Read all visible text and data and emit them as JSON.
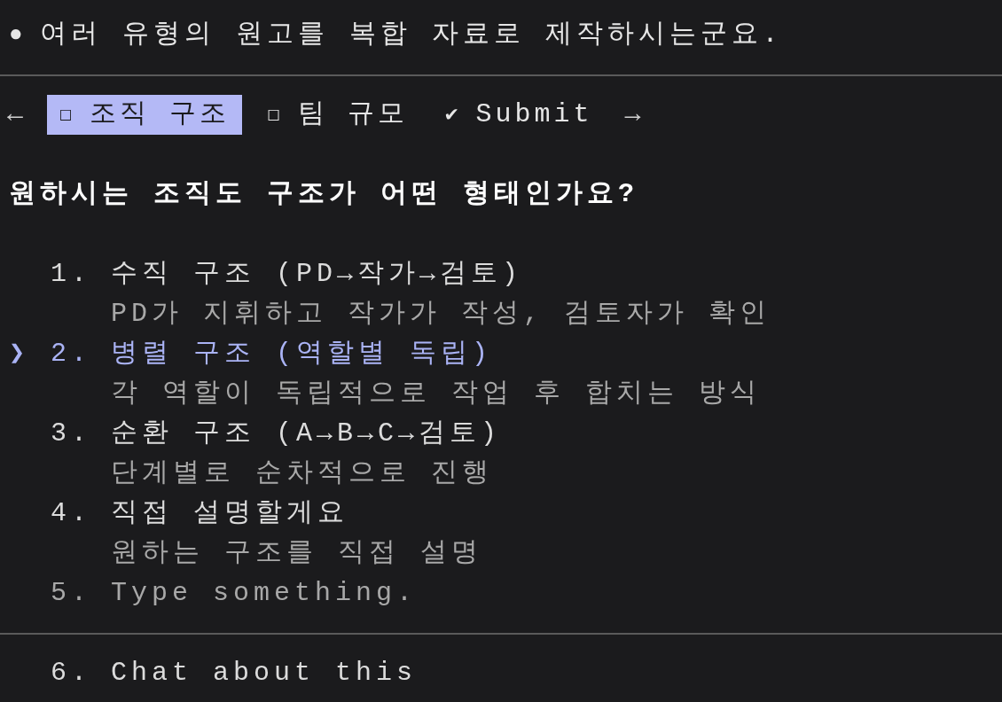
{
  "message": {
    "bullet": "●",
    "text": "여러 유형의 원고를 복합 자료로 제작하시는군요."
  },
  "tabs_bar": {
    "prev": "←",
    "next": "→",
    "tabs": [
      {
        "icon": "☐",
        "label": "조직 구조",
        "selected": true
      },
      {
        "icon": "☐",
        "label": "팀 규모",
        "selected": false
      },
      {
        "icon": "✔",
        "label": "Submit",
        "selected": false
      }
    ]
  },
  "question": "원하시는 조직도 구조가 어떤 형태인가요?",
  "cursor": "❯",
  "options": [
    {
      "kind": "choice",
      "number": "1.",
      "label": "수직 구조 (PD→작가→검토)",
      "description": "PD가 지휘하고 작가가 작성, 검토자가 확인",
      "selected": false
    },
    {
      "kind": "choice",
      "number": "2.",
      "label": "병렬 구조 (역할별 독립)",
      "description": "각 역할이 독립적으로 작업 후 합치는 방식",
      "selected": true
    },
    {
      "kind": "choice",
      "number": "3.",
      "label": "순환 구조 (A→B→C→검토)",
      "description": "단계별로 순차적으로 진행",
      "selected": false
    },
    {
      "kind": "choice",
      "number": "4.",
      "label": "직접 설명할게요",
      "description": "원하는 구조를 직접 설명",
      "selected": false
    },
    {
      "kind": "input",
      "number": "5.",
      "label": "Type something.",
      "selected": false
    }
  ],
  "footer_option": {
    "number": "6.",
    "label": "Chat about this"
  }
}
